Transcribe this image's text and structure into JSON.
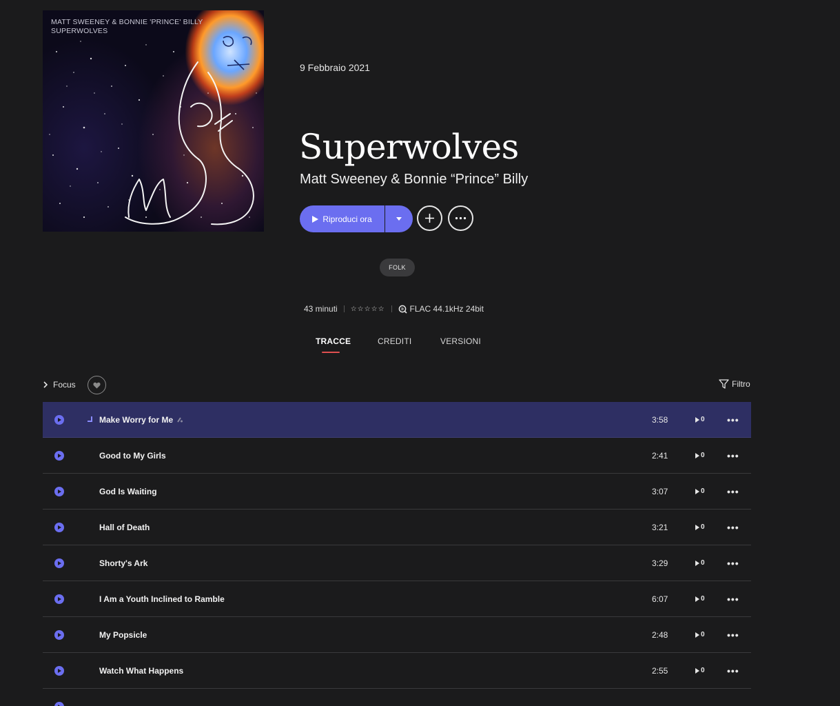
{
  "album": {
    "cover_text_line1": "MATT SWEENEY & BONNIE 'PRINCE' BILLY",
    "cover_text_line2": "SUPERWOLVES",
    "release_date": "9 Febbraio 2021",
    "title": "Superwolves",
    "artist": "Matt Sweeney & Bonnie “Prince” Billy",
    "genre": "FOLK",
    "duration": "43 minuti",
    "rating_stars": "☆☆☆☆☆",
    "quality": "FLAC 44.1kHz 24bit"
  },
  "actions": {
    "play_now": "Riproduci ora",
    "add_icon": "plus-icon",
    "more_icon": "more-icon"
  },
  "tabs": [
    {
      "label": "TRACCE",
      "active": true
    },
    {
      "label": "CREDITI",
      "active": false
    },
    {
      "label": "VERSIONI",
      "active": false
    }
  ],
  "toolbar": {
    "focus_label": "Focus",
    "filter_label": "Filtro"
  },
  "tracks": [
    {
      "title": "Make Worry for Me",
      "duration": "3:58",
      "plays": "0",
      "active": true
    },
    {
      "title": "Good to My Girls",
      "duration": "2:41",
      "plays": "0"
    },
    {
      "title": "God Is Waiting",
      "duration": "3:07",
      "plays": "0"
    },
    {
      "title": "Hall of Death",
      "duration": "3:21",
      "plays": "0"
    },
    {
      "title": "Shorty's Ark",
      "duration": "3:29",
      "plays": "0"
    },
    {
      "title": "I Am a Youth Inclined to Ramble",
      "duration": "6:07",
      "plays": "0"
    },
    {
      "title": "My Popsicle",
      "duration": "2:48",
      "plays": "0"
    },
    {
      "title": "Watch What Happens",
      "duration": "2:55",
      "plays": "0"
    }
  ],
  "colors": {
    "accent": "#6b6ef0",
    "background": "#1b1b1c",
    "active_row": "#2e2f63",
    "tab_underline": "#e05050"
  }
}
